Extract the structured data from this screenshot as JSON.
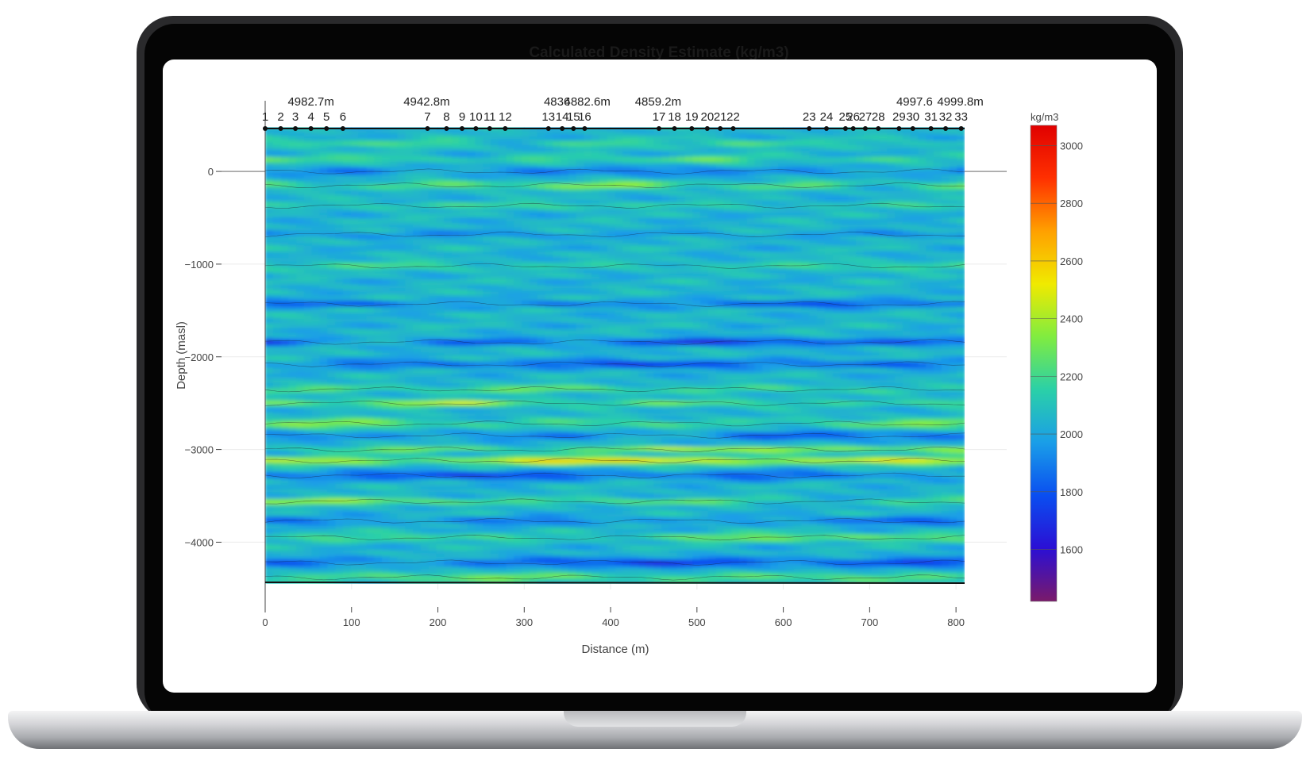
{
  "chart_data": {
    "type": "heatmap",
    "title": "Calculated Density Estimate (kg/m3)",
    "xlabel": "Distance (m)",
    "ylabel": "Depth (masl)",
    "xlim": [
      0,
      810
    ],
    "ylim": [
      -4450,
      480
    ],
    "x_ticks": [
      0,
      100,
      200,
      300,
      400,
      500,
      600,
      700,
      800
    ],
    "y_ticks": [
      0,
      -1000,
      -2000,
      -3000,
      -4000
    ],
    "colorbar": {
      "title": "kg/m3",
      "range": [
        1420,
        3070
      ],
      "ticks": [
        3000,
        2800,
        2600,
        2400,
        2200,
        2000,
        1800,
        1600
      ],
      "colorscale": [
        "#7a1a6a",
        "#2b0fd4",
        "#0a4ef0",
        "#1a9ee8",
        "#2ad0a8",
        "#80ec40",
        "#f0ea00",
        "#ffa000",
        "#ff3000",
        "#e00000"
      ]
    },
    "stations": {
      "labels": [
        "1",
        "2",
        "3",
        "4",
        "5",
        "6",
        "7",
        "8",
        "9",
        "10",
        "11",
        "12",
        "13",
        "14",
        "15",
        "16",
        "17",
        "18",
        "19",
        "20",
        "21",
        "22",
        "23",
        "24",
        "25",
        "26",
        "27",
        "28",
        "29",
        "30",
        "31",
        "32",
        "33"
      ],
      "x": [
        0,
        18,
        35,
        53,
        71,
        90,
        188,
        210,
        228,
        244,
        260,
        278,
        328,
        344,
        357,
        370,
        456,
        474,
        494,
        512,
        527,
        542,
        630,
        650,
        672,
        681,
        695,
        710,
        734,
        750,
        771,
        788,
        806
      ]
    },
    "elevation_labels": [
      {
        "x": 53,
        "text": "4982.7m"
      },
      {
        "x": 187,
        "text": "4942.8m"
      },
      {
        "x": 338,
        "text": "4836"
      },
      {
        "x": 373,
        "text": "4882.6m"
      },
      {
        "x": 455,
        "text": "4859.2m"
      },
      {
        "x": 752,
        "text": "4997.6"
      },
      {
        "x": 805,
        "text": "4999.8m"
      }
    ],
    "density_field": {
      "background": 2050,
      "bands": [
        {
          "depth": 300,
          "value": 2230
        },
        {
          "depth": 130,
          "value": 2280
        },
        {
          "depth": 0,
          "value": 1820
        },
        {
          "depth": -150,
          "value": 2380
        },
        {
          "depth": -370,
          "value": 2240
        },
        {
          "depth": -680,
          "value": 1880
        },
        {
          "depth": -1020,
          "value": 2220
        },
        {
          "depth": -1430,
          "value": 1720
        },
        {
          "depth": -1840,
          "value": 1640
        },
        {
          "depth": -2080,
          "value": 1700
        },
        {
          "depth": -2350,
          "value": 2280
        },
        {
          "depth": -2500,
          "value": 2420
        },
        {
          "depth": -2720,
          "value": 2350
        },
        {
          "depth": -2850,
          "value": 1780
        },
        {
          "depth": -3000,
          "value": 2520
        },
        {
          "depth": -3120,
          "value": 2640
        },
        {
          "depth": -3280,
          "value": 1720
        },
        {
          "depth": -3560,
          "value": 2420
        },
        {
          "depth": -3770,
          "value": 1760
        },
        {
          "depth": -3950,
          "value": 2350
        },
        {
          "depth": -4220,
          "value": 1700
        },
        {
          "depth": -4380,
          "value": 2300
        }
      ]
    }
  }
}
